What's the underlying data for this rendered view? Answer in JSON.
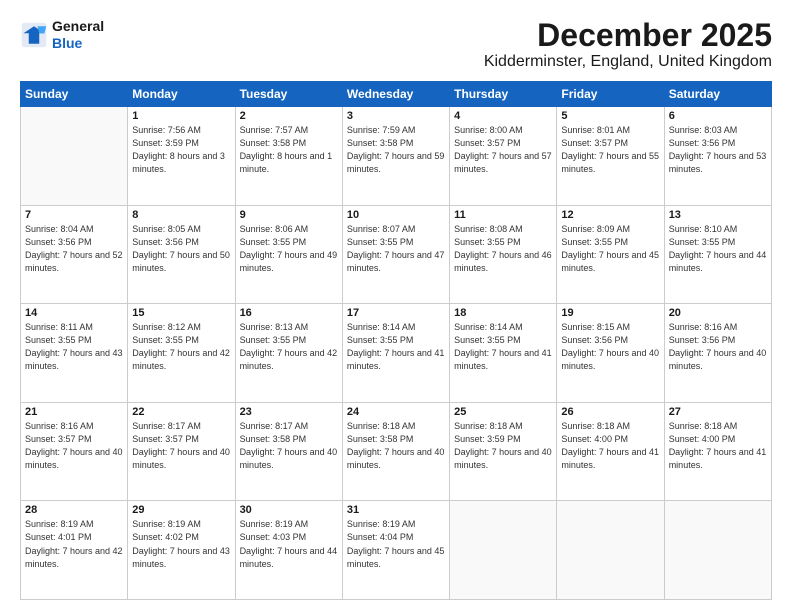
{
  "logo": {
    "line1": "General",
    "line2": "Blue"
  },
  "header": {
    "month": "December 2025",
    "location": "Kidderminster, England, United Kingdom"
  },
  "days_of_week": [
    "Sunday",
    "Monday",
    "Tuesday",
    "Wednesday",
    "Thursday",
    "Friday",
    "Saturday"
  ],
  "weeks": [
    [
      {
        "day": "",
        "sunrise": "",
        "sunset": "",
        "daylight": "",
        "empty": true
      },
      {
        "day": "1",
        "sunrise": "7:56 AM",
        "sunset": "3:59 PM",
        "daylight": "8 hours and 3 minutes.",
        "empty": false
      },
      {
        "day": "2",
        "sunrise": "7:57 AM",
        "sunset": "3:58 PM",
        "daylight": "8 hours and 1 minute.",
        "empty": false
      },
      {
        "day": "3",
        "sunrise": "7:59 AM",
        "sunset": "3:58 PM",
        "daylight": "7 hours and 59 minutes.",
        "empty": false
      },
      {
        "day": "4",
        "sunrise": "8:00 AM",
        "sunset": "3:57 PM",
        "daylight": "7 hours and 57 minutes.",
        "empty": false
      },
      {
        "day": "5",
        "sunrise": "8:01 AM",
        "sunset": "3:57 PM",
        "daylight": "7 hours and 55 minutes.",
        "empty": false
      },
      {
        "day": "6",
        "sunrise": "8:03 AM",
        "sunset": "3:56 PM",
        "daylight": "7 hours and 53 minutes.",
        "empty": false
      }
    ],
    [
      {
        "day": "7",
        "sunrise": "8:04 AM",
        "sunset": "3:56 PM",
        "daylight": "7 hours and 52 minutes.",
        "empty": false
      },
      {
        "day": "8",
        "sunrise": "8:05 AM",
        "sunset": "3:56 PM",
        "daylight": "7 hours and 50 minutes.",
        "empty": false
      },
      {
        "day": "9",
        "sunrise": "8:06 AM",
        "sunset": "3:55 PM",
        "daylight": "7 hours and 49 minutes.",
        "empty": false
      },
      {
        "day": "10",
        "sunrise": "8:07 AM",
        "sunset": "3:55 PM",
        "daylight": "7 hours and 47 minutes.",
        "empty": false
      },
      {
        "day": "11",
        "sunrise": "8:08 AM",
        "sunset": "3:55 PM",
        "daylight": "7 hours and 46 minutes.",
        "empty": false
      },
      {
        "day": "12",
        "sunrise": "8:09 AM",
        "sunset": "3:55 PM",
        "daylight": "7 hours and 45 minutes.",
        "empty": false
      },
      {
        "day": "13",
        "sunrise": "8:10 AM",
        "sunset": "3:55 PM",
        "daylight": "7 hours and 44 minutes.",
        "empty": false
      }
    ],
    [
      {
        "day": "14",
        "sunrise": "8:11 AM",
        "sunset": "3:55 PM",
        "daylight": "7 hours and 43 minutes.",
        "empty": false
      },
      {
        "day": "15",
        "sunrise": "8:12 AM",
        "sunset": "3:55 PM",
        "daylight": "7 hours and 42 minutes.",
        "empty": false
      },
      {
        "day": "16",
        "sunrise": "8:13 AM",
        "sunset": "3:55 PM",
        "daylight": "7 hours and 42 minutes.",
        "empty": false
      },
      {
        "day": "17",
        "sunrise": "8:14 AM",
        "sunset": "3:55 PM",
        "daylight": "7 hours and 41 minutes.",
        "empty": false
      },
      {
        "day": "18",
        "sunrise": "8:14 AM",
        "sunset": "3:55 PM",
        "daylight": "7 hours and 41 minutes.",
        "empty": false
      },
      {
        "day": "19",
        "sunrise": "8:15 AM",
        "sunset": "3:56 PM",
        "daylight": "7 hours and 40 minutes.",
        "empty": false
      },
      {
        "day": "20",
        "sunrise": "8:16 AM",
        "sunset": "3:56 PM",
        "daylight": "7 hours and 40 minutes.",
        "empty": false
      }
    ],
    [
      {
        "day": "21",
        "sunrise": "8:16 AM",
        "sunset": "3:57 PM",
        "daylight": "7 hours and 40 minutes.",
        "empty": false
      },
      {
        "day": "22",
        "sunrise": "8:17 AM",
        "sunset": "3:57 PM",
        "daylight": "7 hours and 40 minutes.",
        "empty": false
      },
      {
        "day": "23",
        "sunrise": "8:17 AM",
        "sunset": "3:58 PM",
        "daylight": "7 hours and 40 minutes.",
        "empty": false
      },
      {
        "day": "24",
        "sunrise": "8:18 AM",
        "sunset": "3:58 PM",
        "daylight": "7 hours and 40 minutes.",
        "empty": false
      },
      {
        "day": "25",
        "sunrise": "8:18 AM",
        "sunset": "3:59 PM",
        "daylight": "7 hours and 40 minutes.",
        "empty": false
      },
      {
        "day": "26",
        "sunrise": "8:18 AM",
        "sunset": "4:00 PM",
        "daylight": "7 hours and 41 minutes.",
        "empty": false
      },
      {
        "day": "27",
        "sunrise": "8:18 AM",
        "sunset": "4:00 PM",
        "daylight": "7 hours and 41 minutes.",
        "empty": false
      }
    ],
    [
      {
        "day": "28",
        "sunrise": "8:19 AM",
        "sunset": "4:01 PM",
        "daylight": "7 hours and 42 minutes.",
        "empty": false
      },
      {
        "day": "29",
        "sunrise": "8:19 AM",
        "sunset": "4:02 PM",
        "daylight": "7 hours and 43 minutes.",
        "empty": false
      },
      {
        "day": "30",
        "sunrise": "8:19 AM",
        "sunset": "4:03 PM",
        "daylight": "7 hours and 44 minutes.",
        "empty": false
      },
      {
        "day": "31",
        "sunrise": "8:19 AM",
        "sunset": "4:04 PM",
        "daylight": "7 hours and 45 minutes.",
        "empty": false
      },
      {
        "day": "",
        "sunrise": "",
        "sunset": "",
        "daylight": "",
        "empty": true
      },
      {
        "day": "",
        "sunrise": "",
        "sunset": "",
        "daylight": "",
        "empty": true
      },
      {
        "day": "",
        "sunrise": "",
        "sunset": "",
        "daylight": "",
        "empty": true
      }
    ]
  ]
}
